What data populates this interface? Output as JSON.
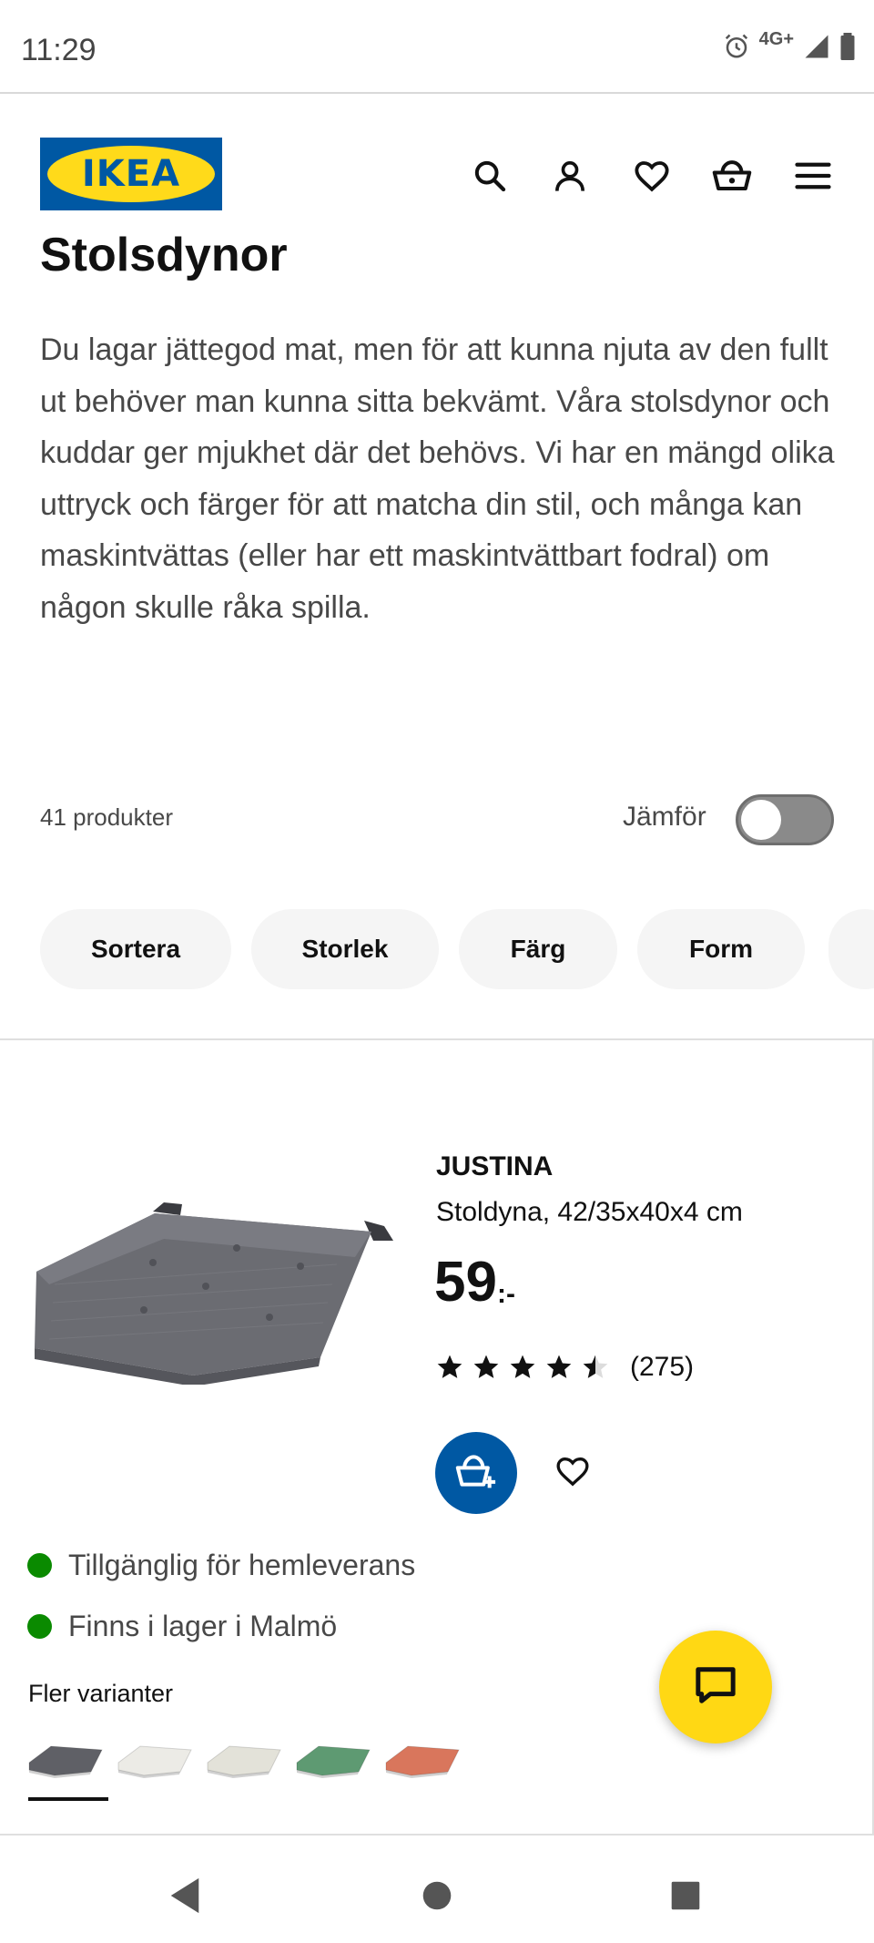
{
  "status_bar": {
    "time": "11:29",
    "network": "4G+"
  },
  "header": {
    "logo_text": "IKEA"
  },
  "page": {
    "title": "Stolsdynor",
    "intro": "Du lagar jättegod mat, men för att kunna njuta av den fullt ut behöver man kunna sitta bekvämt. Våra stolsdynor och kuddar ger mjukhet där det behövs. Vi har en mängd olika uttryck och färger för att matcha din stil, och många kan maskintvättas (eller har ett maskintvättbart fodral) om någon skulle råka spilla."
  },
  "toolbar": {
    "count": "41 produkter",
    "compare_label": "Jämför",
    "compare_on": false
  },
  "filters": [
    "Sortera",
    "Storlek",
    "Färg",
    "Form"
  ],
  "product": {
    "name": "JUSTINA",
    "description": "Stoldyna, 42/35x40x4 cm",
    "price": "59",
    "price_suffix": ":-",
    "rating": 4.5,
    "rating_count": "(275)",
    "availability": [
      "Tillgänglig för hemleverans",
      "Finns i lager i Malmö"
    ],
    "variants_label": "Fler varianter",
    "variant_colors": [
      "#5f6066",
      "#ecebe6",
      "#e3e2d9",
      "#5e9a72",
      "#d9765c"
    ],
    "selected_variant": 0,
    "availability_color": "#0a8a00"
  },
  "colors": {
    "brand_blue": "#0058a3",
    "brand_yellow": "#ffda1a",
    "chat_yellow": "#ffd814"
  },
  "icons": [
    "search-icon",
    "user-icon",
    "heart-icon",
    "basket-icon",
    "menu-icon",
    "chat-icon",
    "back-icon",
    "home-icon",
    "recents-icon"
  ]
}
